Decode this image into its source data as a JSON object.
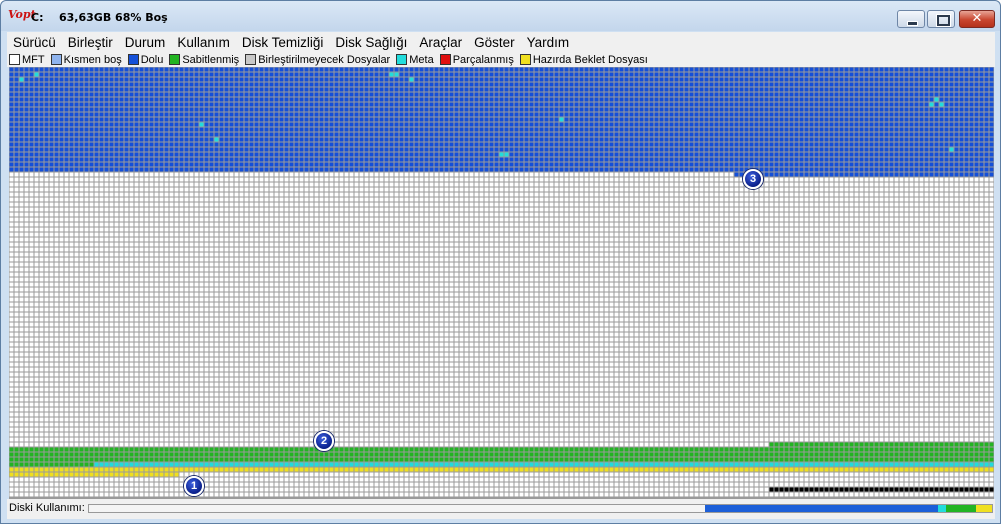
{
  "window": {
    "logo": "Vopt",
    "drive": "C:",
    "free_space": "63,63GB 68% Boş"
  },
  "menu": [
    "Sürücü",
    "Birleştir",
    "Durum",
    "Kullanım",
    "Disk Temizliği",
    "Disk Sağlığı",
    "Araçlar",
    "Göster",
    "Yardım"
  ],
  "legend": [
    {
      "label": "MFT",
      "color": "#ffffff"
    },
    {
      "label": "Kısmen boş",
      "color": "#8fb4ef"
    },
    {
      "label": "Dolu",
      "color": "#1550d8"
    },
    {
      "label": "Sabitlenmiş",
      "color": "#22b422"
    },
    {
      "label": "Birleştirilmeyecek Dosyalar",
      "color": "#c8c8c8"
    },
    {
      "label": "Meta",
      "color": "#22dcdc"
    },
    {
      "label": "Parçalanmış",
      "color": "#e01010"
    },
    {
      "label": "Hazırda Beklet Dosyası",
      "color": "#f0e020"
    }
  ],
  "markers": [
    "1",
    "2",
    "3"
  ],
  "status": {
    "label": "Diski Kullanımı:",
    "usage_segments": [
      {
        "state": "free",
        "fraction": 0.682,
        "color": "#f4f4f4"
      },
      {
        "state": "used",
        "fraction": 0.258,
        "color": "#1c5fd8"
      },
      {
        "state": "meta",
        "fraction": 0.009,
        "color": "#22dcdc"
      },
      {
        "state": "fixed",
        "fraction": 0.033,
        "color": "#22b422"
      },
      {
        "state": "hibernate",
        "fraction": 0.018,
        "color": "#f0e020"
      }
    ]
  }
}
